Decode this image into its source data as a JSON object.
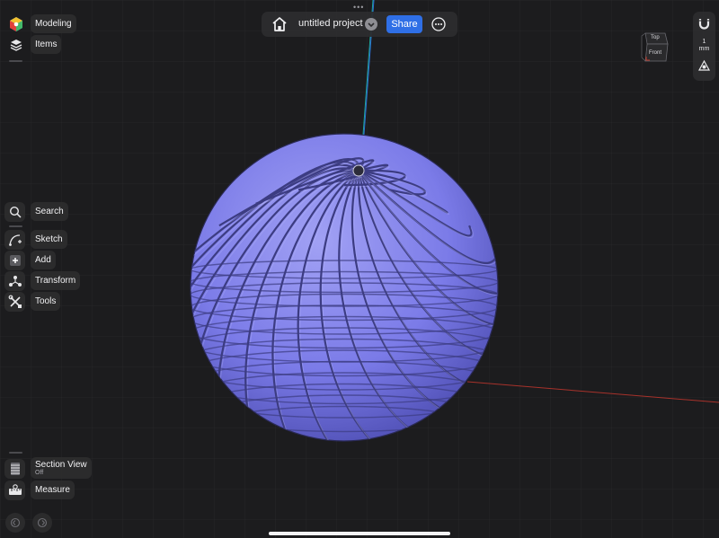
{
  "top_bar": {
    "project_title": "untitled project",
    "share_label": "Share"
  },
  "left_top": {
    "modeling_label": "Modeling",
    "items_label": "Items"
  },
  "left_tools": {
    "search_label": "Search",
    "sketch_label": "Sketch",
    "add_label": "Add",
    "transform_label": "Transform",
    "tools_label": "Tools"
  },
  "left_bottom": {
    "section_view_label": "Section View",
    "section_view_status": "Off",
    "measure_label": "Measure"
  },
  "view_cube": {
    "top_label": "Top",
    "front_label": "Front"
  },
  "units": {
    "value": "1",
    "unit": "mm"
  },
  "model": {
    "color": "#7b7be8",
    "highlight_color": "#a1a1f4",
    "shadow_color": "#4f4fb4",
    "stripe_count": 24
  },
  "colors": {
    "accent": "#2f6fe6",
    "background": "#1c1c1e",
    "axis_x": "#c0392b",
    "axis_y": "#1fa89c"
  },
  "icons": {
    "home": "home-icon",
    "more": "ellipsis-circle-icon",
    "magnet": "magnet-icon",
    "pivot": "pivot-icon"
  }
}
